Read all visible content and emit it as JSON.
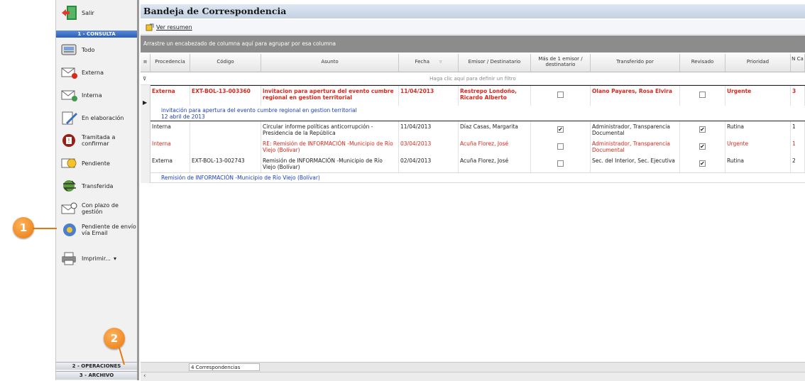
{
  "app": {
    "title": "Bandeja de Correspondencia"
  },
  "sidebar": {
    "exit_label": "Salir",
    "section1": "1 - CONSULTA",
    "items": [
      {
        "label": "Todo",
        "icon": "inbox-all-icon"
      },
      {
        "label": "Externa",
        "icon": "external-mail-icon"
      },
      {
        "label": "Interna",
        "icon": "internal-mail-icon"
      },
      {
        "label": "En elaboración",
        "icon": "drafting-icon"
      },
      {
        "label": "Tramitada a confirmar",
        "icon": "processed-confirm-icon"
      },
      {
        "label": "Pendiente",
        "icon": "pending-icon"
      },
      {
        "label": "Transferida",
        "icon": "transferred-icon"
      },
      {
        "label": "Con plazo de gestión",
        "icon": "deadline-mail-icon"
      },
      {
        "label": "Pendiente de envío vía Email",
        "icon": "email-pending-icon"
      },
      {
        "label": "Imprimir...",
        "icon": "printer-icon"
      }
    ],
    "section2": "2 - OPERACIONES",
    "section3": "3 - ARCHIVO"
  },
  "toolbar": {
    "summary_label": "Ver resumen"
  },
  "grid": {
    "group_hint": "Arrastre un encabezado de columna aquí para agrupar por esa columna",
    "filter_hint": "Haga clic aquí para definir un filtro",
    "columns": [
      "Procedencia",
      "Código",
      "Asunto",
      "Fecha",
      "Emisor / Destinatario",
      "Más de 1 emisor / destinatario",
      "Transferido por",
      "Revisado",
      "Prioridad",
      "N Ca"
    ],
    "rows": [
      {
        "procedencia": "Externa",
        "codigo": "EXT-BOL-13-003360",
        "asunto": "invitacion para apertura del evento cumbre regional en gestion territorial",
        "fecha": "11/04/2013",
        "emisor": "Restrepo Londoño, Ricardo Alberto",
        "mas_emisor": false,
        "transferido": "Olano Payares, Rosa Elvira",
        "revisado": false,
        "prioridad": "Urgente",
        "n": "3"
      },
      {
        "procedencia": "Interna",
        "codigo": "",
        "asunto": "Circular informe políticas anticorrupción - Presidencia de la República",
        "fecha": "11/04/2013",
        "emisor": "Díaz Casas, Margarita",
        "mas_emisor": true,
        "transferido": "Administrador, Transparencia Documental",
        "revisado": true,
        "prioridad": "Rutina",
        "n": "1"
      },
      {
        "procedencia": "Interna",
        "codigo": "",
        "asunto": "RE: Remisión de INFORMACIÓN -Municipio de Río Viejo (Bolívar)",
        "fecha": "03/04/2013",
        "emisor": "Acuña Florez, José",
        "mas_emisor": false,
        "transferido": "Administrador, Transparencia Documental",
        "revisado": true,
        "prioridad": "Urgente",
        "n": "1"
      },
      {
        "procedencia": "Externa",
        "codigo": "EXT-BOL-13-002743",
        "asunto": "Remisión de INFORMACIÓN -Municipio de Río Viejo (Bolívar)",
        "fecha": "02/04/2013",
        "emisor": "Acuña Florez, José",
        "mas_emisor": false,
        "transferido": "Sec. del Interior, Sec. Ejecutiva",
        "revisado": true,
        "prioridad": "Rutina",
        "n": "2"
      }
    ],
    "preview1_line1": "invitación para apertura del evento cumbre regional en gestion territorial",
    "preview1_line2": "12 abril de 2013",
    "preview4": "Remisión de INFORMACIÓN -Municipio de Río Viejo (Bolívar)"
  },
  "footer": {
    "count": "4 Correspondencias"
  },
  "callouts": [
    "1",
    "2"
  ],
  "colors": {
    "accent": "#2a5fb8",
    "urgent_red": "#d9281e",
    "callout_orange": "#e7780d"
  }
}
